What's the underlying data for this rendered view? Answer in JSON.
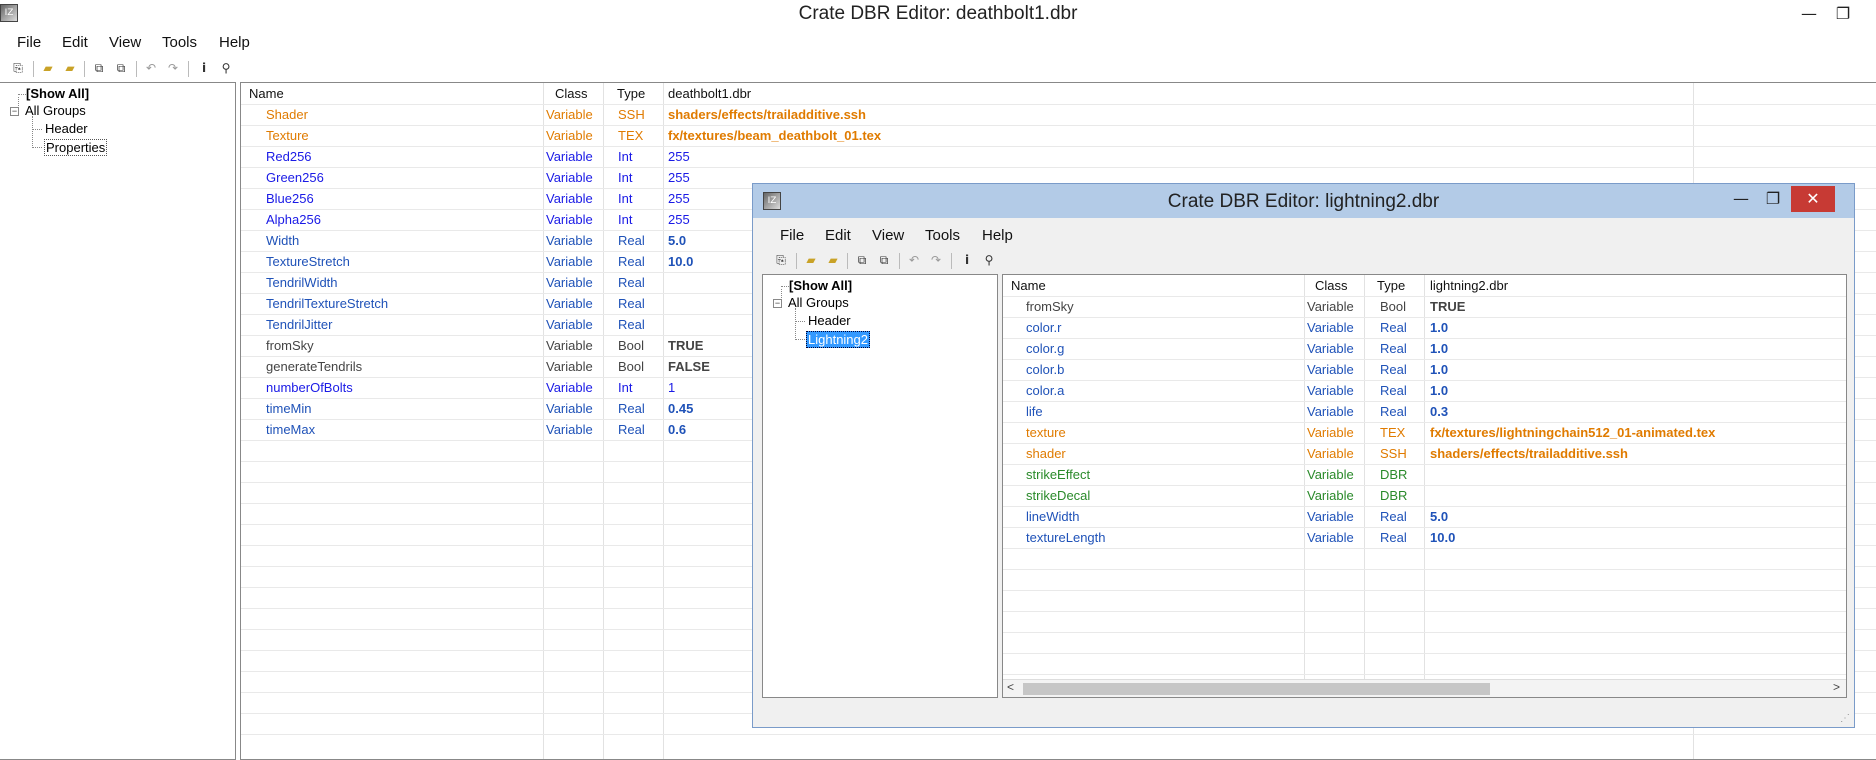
{
  "main": {
    "title": "Crate DBR Editor: deathbolt1.dbr",
    "menu": [
      "File",
      "Edit",
      "View",
      "Tools",
      "Help"
    ],
    "tree": {
      "show_all": "[Show All]",
      "all_groups": "All Groups",
      "children": [
        "Header",
        "Properties"
      ]
    },
    "columns": {
      "name": "Name",
      "class": "Class",
      "type": "Type",
      "value": "deathbolt1.dbr"
    },
    "rows": [
      {
        "name": "Shader",
        "class": "Variable",
        "type": "SSH",
        "value": "shaders/effects/trailadditive.ssh",
        "color": "#e07b00"
      },
      {
        "name": "Texture",
        "class": "Variable",
        "type": "TEX",
        "value": "fx/textures/beam_deathbolt_01.tex",
        "color": "#e07b00"
      },
      {
        "name": "Red256",
        "class": "Variable",
        "type": "Int",
        "value": "255",
        "color": "#1a1ae6"
      },
      {
        "name": "Green256",
        "class": "Variable",
        "type": "Int",
        "value": "255",
        "color": "#1a1ae6"
      },
      {
        "name": "Blue256",
        "class": "Variable",
        "type": "Int",
        "value": "255",
        "color": "#1a1ae6"
      },
      {
        "name": "Alpha256",
        "class": "Variable",
        "type": "Int",
        "value": "255",
        "color": "#1a1ae6"
      },
      {
        "name": "Width",
        "class": "Variable",
        "type": "Real",
        "value": "5.0",
        "color": "#1f52b8"
      },
      {
        "name": "TextureStretch",
        "class": "Variable",
        "type": "Real",
        "value": "10.0",
        "color": "#1f52b8"
      },
      {
        "name": "TendrilWidth",
        "class": "Variable",
        "type": "Real",
        "value": "",
        "color": "#1f52b8"
      },
      {
        "name": "TendrilTextureStretch",
        "class": "Variable",
        "type": "Real",
        "value": "",
        "color": "#1f52b8"
      },
      {
        "name": "TendrilJitter",
        "class": "Variable",
        "type": "Real",
        "value": "",
        "color": "#1f52b8"
      },
      {
        "name": "fromSky",
        "class": "Variable",
        "type": "Bool",
        "value": "TRUE",
        "color": "#444444"
      },
      {
        "name": "generateTendrils",
        "class": "Variable",
        "type": "Bool",
        "value": "FALSE",
        "color": "#444444"
      },
      {
        "name": "numberOfBolts",
        "class": "Variable",
        "type": "Int",
        "value": "1",
        "color": "#1a1ae6"
      },
      {
        "name": "timeMin",
        "class": "Variable",
        "type": "Real",
        "value": "0.45",
        "color": "#1f52b8"
      },
      {
        "name": "timeMax",
        "class": "Variable",
        "type": "Real",
        "value": "0.6",
        "color": "#1f52b8"
      }
    ]
  },
  "float": {
    "title": "Crate DBR Editor: lightning2.dbr",
    "menu": [
      "File",
      "Edit",
      "View",
      "Tools",
      "Help"
    ],
    "tree": {
      "show_all": "[Show All]",
      "all_groups": "All Groups",
      "children": [
        "Header",
        "Lightning2"
      ]
    },
    "columns": {
      "name": "Name",
      "class": "Class",
      "type": "Type",
      "value": "lightning2.dbr"
    },
    "rows": [
      {
        "name": "fromSky",
        "class": "Variable",
        "type": "Bool",
        "value": "TRUE",
        "color": "#444444"
      },
      {
        "name": "color.r",
        "class": "Variable",
        "type": "Real",
        "value": "1.0",
        "color": "#1f52b8"
      },
      {
        "name": "color.g",
        "class": "Variable",
        "type": "Real",
        "value": "1.0",
        "color": "#1f52b8"
      },
      {
        "name": "color.b",
        "class": "Variable",
        "type": "Real",
        "value": "1.0",
        "color": "#1f52b8"
      },
      {
        "name": "color.a",
        "class": "Variable",
        "type": "Real",
        "value": "1.0",
        "color": "#1f52b8"
      },
      {
        "name": "life",
        "class": "Variable",
        "type": "Real",
        "value": "0.3",
        "color": "#1f52b8"
      },
      {
        "name": "texture",
        "class": "Variable",
        "type": "TEX",
        "value": "fx/textures/lightningchain512_01-animated.tex",
        "color": "#e07b00"
      },
      {
        "name": "shader",
        "class": "Variable",
        "type": "SSH",
        "value": "shaders/effects/trailadditive.ssh",
        "color": "#e07b00"
      },
      {
        "name": "strikeEffect",
        "class": "Variable",
        "type": "DBR",
        "value": "",
        "color": "#2a8a2a"
      },
      {
        "name": "strikeDecal",
        "class": "Variable",
        "type": "DBR",
        "value": "",
        "color": "#2a8a2a"
      },
      {
        "name": "lineWidth",
        "class": "Variable",
        "type": "Real",
        "value": "5.0",
        "color": "#1f52b8"
      },
      {
        "name": "textureLength",
        "class": "Variable",
        "type": "Real",
        "value": "10.0",
        "color": "#1f52b8"
      }
    ]
  },
  "colors": {
    "selection": "#3399ff",
    "titlebar_active": "#b3cbe7",
    "close_red": "#c73a34"
  }
}
